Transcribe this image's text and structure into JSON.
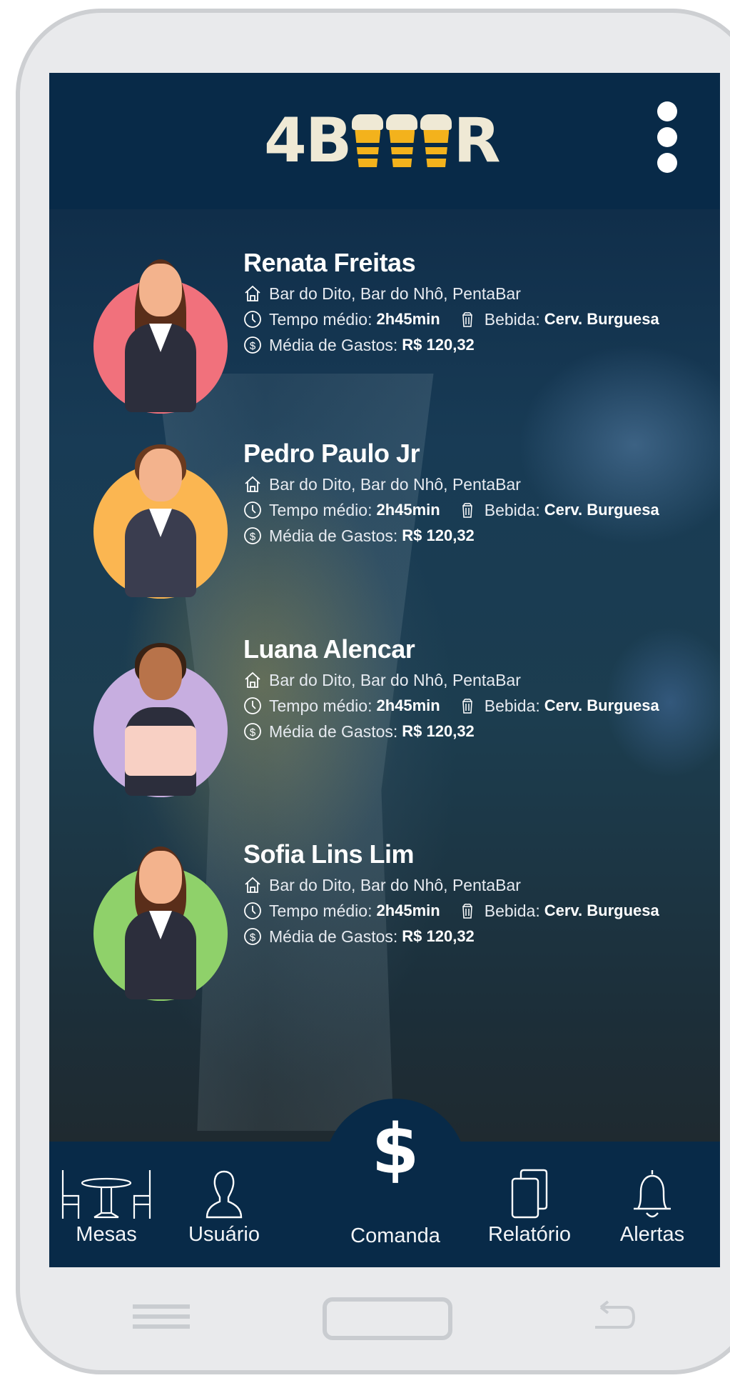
{
  "header": {
    "logo_prefix": "4B",
    "logo_suffix": "R",
    "menu_icon": "more-vertical-icon"
  },
  "users": [
    {
      "name": "Renata Freitas",
      "bars": "Bar do Dito, Bar do Nhô, PentaBar",
      "tempo_label": "Tempo médio:",
      "tempo_value": "2h45min",
      "bebida_label": "Bebida:",
      "bebida_value": "Cerv. Burguesa",
      "gastos_label": "Média de Gastos:",
      "gastos_value": "R$ 120,32",
      "avatar_color": "#f1717c"
    },
    {
      "name": "Pedro Paulo Jr",
      "bars": "Bar do Dito, Bar do Nhô, PentaBar",
      "tempo_label": "Tempo médio:",
      "tempo_value": "2h45min",
      "bebida_label": "Bebida:",
      "bebida_value": "Cerv. Burguesa",
      "gastos_label": "Média de Gastos:",
      "gastos_value": "R$ 120,32",
      "avatar_color": "#fbb651"
    },
    {
      "name": "Luana Alencar",
      "bars": "Bar do Dito, Bar do Nhô, PentaBar",
      "tempo_label": "Tempo médio:",
      "tempo_value": "2h45min",
      "bebida_label": "Bebida:",
      "bebida_value": "Cerv. Burguesa",
      "gastos_label": "Média de Gastos:",
      "gastos_value": "R$ 120,32",
      "avatar_color": "#c7aee0"
    },
    {
      "name": "Sofia Lins Lim",
      "bars": "Bar do Dito, Bar do Nhô, PentaBar",
      "tempo_label": "Tempo médio:",
      "tempo_value": "2h45min",
      "bebida_label": "Bebida:",
      "bebida_value": "Cerv. Burguesa",
      "gastos_label": "Média de Gastos:",
      "gastos_value": "R$ 120,32",
      "avatar_color": "#8fd16a"
    }
  ],
  "nav": {
    "mesas": "Mesas",
    "usuario": "Usuário",
    "comanda": "Comanda",
    "comanda_symbol": "$",
    "relatorio": "Relatório",
    "alertas": "Alertas"
  },
  "colors": {
    "header_bg": "#082a48",
    "logo_cream": "#efe9d5",
    "beer_yellow": "#f3b21c"
  }
}
